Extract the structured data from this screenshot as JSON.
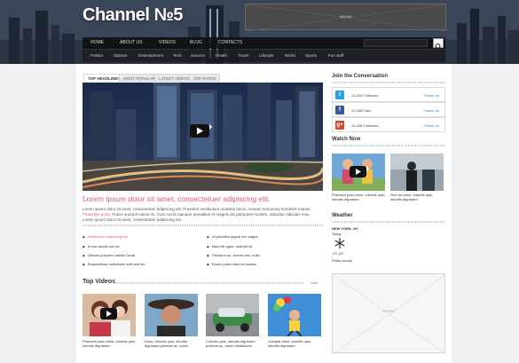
{
  "header": {
    "logo": "Channel №5",
    "banner_label": "468X60",
    "nav": [
      "HOME",
      "ABOUT US",
      "VIDEOS",
      "BLOG",
      "CONTACTS"
    ],
    "categories": [
      "Politics",
      "Opinion",
      "Entertainment",
      "Tech",
      "Science",
      "Health",
      "Travel",
      "Lifestyle",
      "World",
      "Sports",
      "Fun stuff"
    ]
  },
  "tabs": [
    "TOP HEADLINES",
    "MOST POPULAR",
    "LATEST VIDEOS",
    "TOP RATED"
  ],
  "featured": {
    "title": "Lorem ipsum dolor sit amet, consectetuer adipiscing elit.",
    "body_1": "Lorem ipsum dolor sit amet, consectetuer adipiscing elit. Praesent vestibulum molestie lacus. Aenean nonummy hendrerit mauris.",
    "body_link": "Phasellus porta.",
    "body_2": "Fusce suscipit varius mi. Cum sociis natoque penatibus et magnis dis parturient montes, nascetur ridiculus mus. Lorem ipsum dolor sit amet, consectetuer adipiscing elit."
  },
  "bullets_left": [
    "Vestibulum adipiscing est",
    "In hac iaculis est vel",
    "Ultrices posuere cubilia Curae",
    "Suspendisse sollicitudin velit sed leo"
  ],
  "bullets_right": [
    "Ut pharetra augue nec augue",
    "Nam elit agna, endrerit sit",
    "Tincidunt ac, viverra sed, nulla",
    "Donec porta diam eu massa"
  ],
  "top_videos": {
    "heading": "Top Videos",
    "more": "more",
    "items": [
      {
        "caption": "Praesent justo dolor, lobortis quis, lobortis dignissim"
      },
      {
        "caption": "Dolor, lobortis quis, lobortis dignissim pulvinar ac, lorem"
      },
      {
        "caption": "Lobortis quis, lobortis dignissim pulvinar ac, lorem vestibulum"
      },
      {
        "caption": "Volutpat dolor, lobortis quis, lobortis dignissim"
      }
    ]
  },
  "sidebar": {
    "conversation_heading": "Join the Conversation",
    "social": [
      {
        "icon": "t",
        "count": "12,436 Followers",
        "follow": "Follow Us",
        "color": "#2f9fd8"
      },
      {
        "icon": "f",
        "count": "12,436 Fans",
        "follow": "Follow Us",
        "color": "#3b5998"
      },
      {
        "icon": "g+",
        "count": "12,436 Followers",
        "follow": "Follow Us",
        "color": "#d34836"
      }
    ],
    "watch_heading": "Watch Now",
    "watch": [
      {
        "caption": "Praesent justo dolor, lobortis quis, lobortis dignissim"
      },
      {
        "caption": "Sed ulo dolor, lobortis quis, lobortis dignissim"
      }
    ],
    "weather_heading": "Weather",
    "weather": {
      "city": "NEW YORK, NY",
      "day": "Today",
      "temp": "-3°/-10°",
      "condition": "Partly cloudy"
    },
    "ad_label": "300X250"
  },
  "colors": {
    "accent_pink": "#e0597a",
    "nav_bg": "#111111",
    "link_blue": "#3a7fc9"
  }
}
